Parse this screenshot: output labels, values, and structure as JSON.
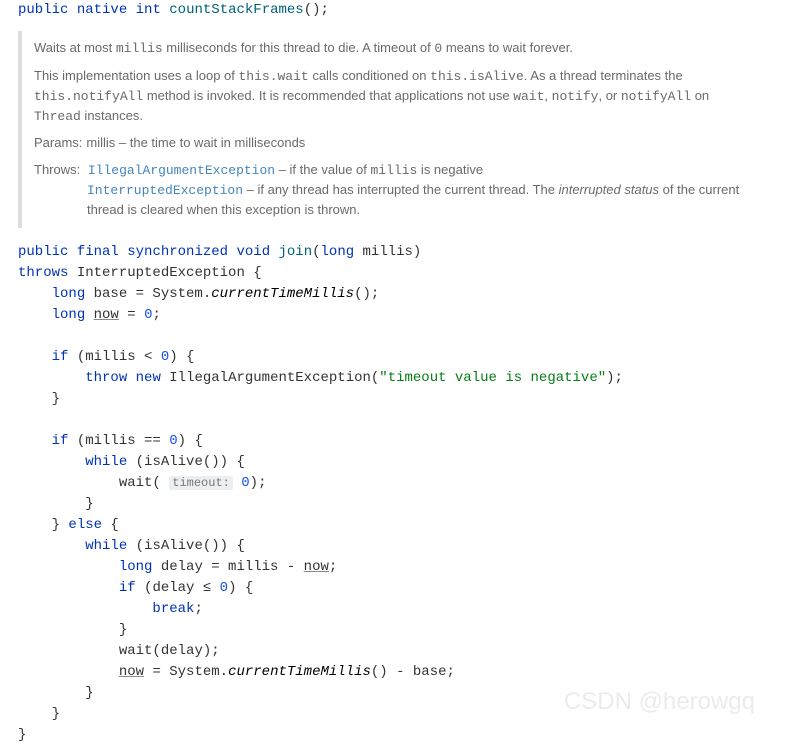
{
  "sig1": {
    "public": "public",
    "native": "native",
    "int": "int",
    "name": "countStackFrames",
    "tail": "();"
  },
  "doc": {
    "p1_a": "Waits at most ",
    "p1_millis": "millis",
    "p1_b": " milliseconds for this thread to die. A timeout of ",
    "p1_zero": "0",
    "p1_c": " means to wait forever.",
    "p2_a": "This implementation uses a loop of ",
    "p2_wait": "this.wait",
    "p2_b": " calls conditioned on ",
    "p2_alive": "this.isAlive",
    "p2_c": ". As a thread terminates the ",
    "p2_notify": "this.notifyAll",
    "p2_d": " method is invoked. It is recommended that applications not use ",
    "p2_w": "wait",
    "p2_comma1": ", ",
    "p2_n": "notify",
    "p2_comma2": ", or ",
    "p2_na": "notifyAll",
    "p2_on": " on ",
    "p2_thread": "Thread",
    "p2_inst": " instances.",
    "params_label": "Params:",
    "params_text": "millis – the time to wait in milliseconds",
    "throws_label": "Throws:",
    "iae": "IllegalArgumentException",
    "iae_desc": " – if the value of ",
    "iae_millis": "millis",
    "iae_tail": " is negative",
    "ie": "InterruptedException",
    "ie_desc": " – if any thread has interrupted the current thread. The ",
    "ie_status": "interrupted status",
    "ie_tail": " of the current thread is cleared when this exception is thrown."
  },
  "code": {
    "l1_public": "public",
    "l1_final": "final",
    "l1_sync": "synchronized",
    "l1_void": "void",
    "l1_join": "join",
    "l1_lp": "(",
    "l1_long": "long",
    "l1_millis": " millis)",
    "l2_throws": "throws",
    "l2_exc": " InterruptedException {",
    "l3_long": "long",
    "l3_base": " base = System.",
    "l3_ctm": "currentTimeMillis",
    "l3_tail": "();",
    "l4_long": "long",
    "l4_sp": " ",
    "l4_now": "now",
    "l4_eq": " = ",
    "l4_zero": "0",
    "l4_semi": ";",
    "l6_if": "if",
    "l6_cond_a": " (millis < ",
    "l6_zero": "0",
    "l6_cond_b": ") {",
    "l7_throw": "throw",
    "l7_new": "new",
    "l7_iae": " IllegalArgumentException(",
    "l7_str": "\"timeout value is negative\"",
    "l7_tail": ");",
    "l8_brace": "}",
    "l10_if": "if",
    "l10_a": " (millis == ",
    "l10_zero": "0",
    "l10_b": ") {",
    "l11_while": "while",
    "l11_a": " (isAlive()) {",
    "l12_wait_a": "wait( ",
    "l12_hint": "timeout:",
    "l12_sp": " ",
    "l12_zero": "0",
    "l12_wait_b": ");",
    "l13_brace": "}",
    "l14": "} ",
    "l14_else": "else",
    "l14_b": " {",
    "l15_while": "while",
    "l15_a": " (isAlive()) {",
    "l16_long": "long",
    "l16_a": " delay = millis - ",
    "l16_now": "now",
    "l16_b": ";",
    "l17_if": "if",
    "l17_a": " (delay ≤ ",
    "l17_zero": "0",
    "l17_b": ") {",
    "l18_break": "break",
    "l18_semi": ";",
    "l19_brace": "}",
    "l20": "wait(delay);",
    "l21_now": "now",
    "l21_a": " = System.",
    "l21_ctm": "currentTimeMillis",
    "l21_b": "() - base;",
    "l22_brace": "}",
    "l23_brace": "}",
    "l24_brace": "}"
  },
  "watermark": "CSDN @herowgq"
}
